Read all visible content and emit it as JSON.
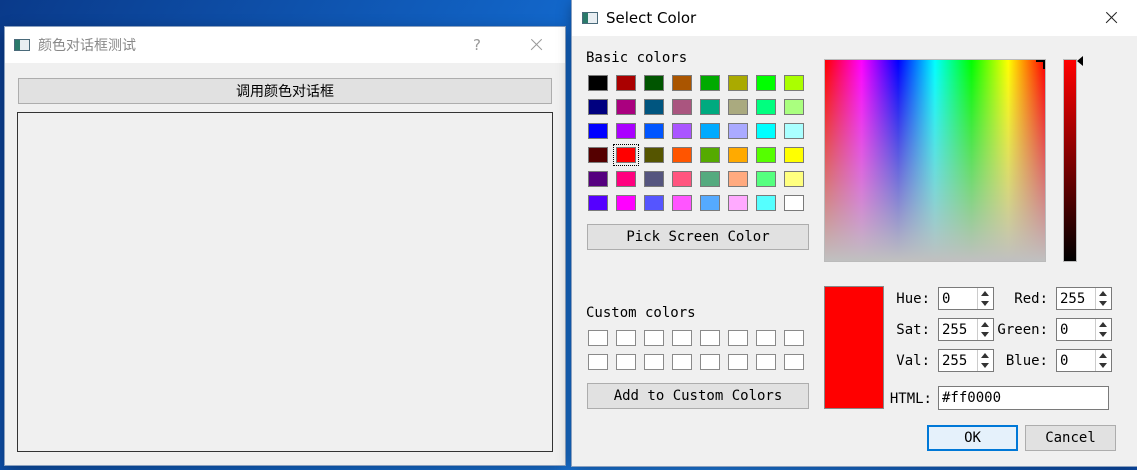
{
  "main_window": {
    "title": "颜色对话框测试",
    "help_glyph": "?",
    "open_button_label": "调用颜色对话框"
  },
  "dialog": {
    "title": "Select Color",
    "basic_colors_label": "Basic colors",
    "basic_colors": [
      [
        "#000000",
        "#aa0000",
        "#005500",
        "#aa5500",
        "#00aa00",
        "#aaaa00",
        "#00ff00",
        "#aaff00"
      ],
      [
        "#00007f",
        "#aa007f",
        "#00557f",
        "#aa557f",
        "#00aa7f",
        "#aaaa7f",
        "#00ff7f",
        "#aaff7f"
      ],
      [
        "#0000ff",
        "#aa00ff",
        "#0055ff",
        "#aa55ff",
        "#00aaff",
        "#aaaaff",
        "#00ffff",
        "#aaffff"
      ],
      [
        "#550000",
        "#ff0000",
        "#555500",
        "#ff5500",
        "#55aa00",
        "#ffaa00",
        "#55ff00",
        "#ffff00"
      ],
      [
        "#55007f",
        "#ff007f",
        "#55557f",
        "#ff557f",
        "#55aa7f",
        "#ffaa7f",
        "#55ff7f",
        "#ffff7f"
      ],
      [
        "#5500ff",
        "#ff00ff",
        "#5555ff",
        "#ff55ff",
        "#55aaff",
        "#ffaaff",
        "#55ffff",
        "#ffffff"
      ]
    ],
    "pick_screen_label": "Pick Screen Color",
    "custom_colors_label": "Custom colors",
    "add_custom_label": "Add to Custom Colors",
    "fields": {
      "hue_label": "Hue:",
      "hue_value": "0",
      "sat_label": "Sat:",
      "sat_value": "255",
      "val_label": "Val:",
      "val_value": "255",
      "red_label": "Red:",
      "red_value": "255",
      "green_label": "Green:",
      "green_value": "0",
      "blue_label": "Blue:",
      "blue_value": "0",
      "html_label": "HTML:",
      "html_value": "#ff0000"
    },
    "current_color": "#ff0000",
    "ok_label": "OK",
    "cancel_label": "Cancel"
  }
}
